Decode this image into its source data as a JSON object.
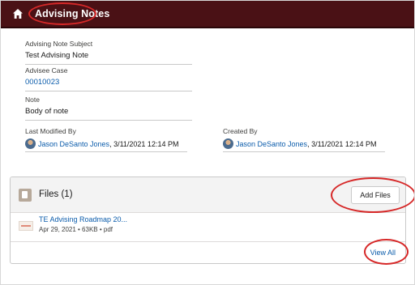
{
  "topbar": {
    "title": "Advising Notes",
    "home_icon": "home-icon"
  },
  "fields": {
    "subject": {
      "label": "Advising Note Subject",
      "value": "Test Advising Note"
    },
    "advisee_case": {
      "label": "Advisee Case",
      "value": "00010023"
    },
    "note": {
      "label": "Note",
      "value": "Body of note"
    }
  },
  "last_modified": {
    "label": "Last Modified By",
    "name": "Jason DeSanto Jones",
    "date": ", 3/11/2021 12:14 PM"
  },
  "created_by": {
    "label": "Created By",
    "name": "Jason DeSanto Jones",
    "date": ", 3/11/2021 12:14 PM"
  },
  "files": {
    "title": "Files (1)",
    "add_label": "Add Files",
    "items": [
      {
        "name": "TE Advising Roadmap 20...",
        "meta": "Apr 29, 2021 • 63KB • pdf"
      }
    ],
    "view_all_label": "View All"
  },
  "colors": {
    "topbar": "#4a1115",
    "link": "#0b5cab",
    "annotation": "#d62828"
  }
}
